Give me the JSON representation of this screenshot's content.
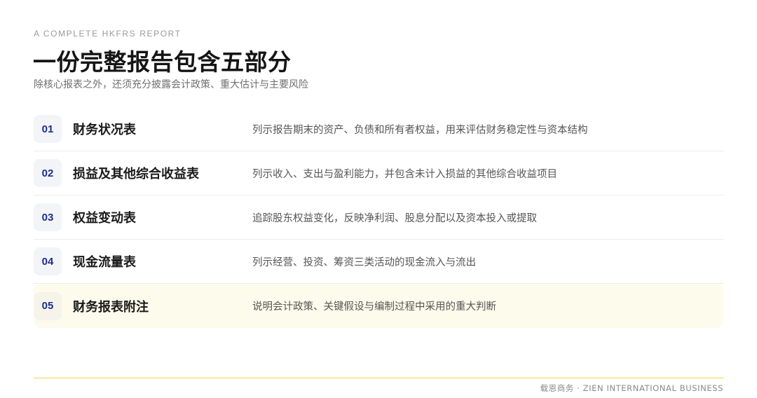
{
  "header": {
    "eyebrow": "A COMPLETE HKFRS REPORT",
    "title": "一份完整报告包含五部分",
    "subtitle": "除核心报表之外，还须充分披露会计政策、重大估计与主要风险"
  },
  "items": [
    {
      "num": "01",
      "name": "财务状况表",
      "desc": "列示报告期末的资产、负债和所有者权益，用来评估财务稳定性与资本结构",
      "highlight": false
    },
    {
      "num": "02",
      "name": "损益及其他综合收益表",
      "desc": "列示收入、支出与盈利能力，并包含未计入损益的其他综合收益项目",
      "highlight": false
    },
    {
      "num": "03",
      "name": "权益变动表",
      "desc": "追踪股东权益变化，反映净利润、股息分配以及资本投入或提取",
      "highlight": false
    },
    {
      "num": "04",
      "name": "现金流量表",
      "desc": "列示经营、投资、筹资三类活动的现金流入与流出",
      "highlight": false
    },
    {
      "num": "05",
      "name": "财务报表附注",
      "desc": "说明会计政策、关键假设与编制过程中采用的重大判断",
      "highlight": true
    }
  ],
  "footer": {
    "text": "载恩商务 · ZIEN INTERNATIONAL BUSINESS"
  },
  "colors": {
    "accent_number": "#1c2f8a",
    "highlight_bg": "#fdfbec",
    "rule": "#ecd24a"
  }
}
